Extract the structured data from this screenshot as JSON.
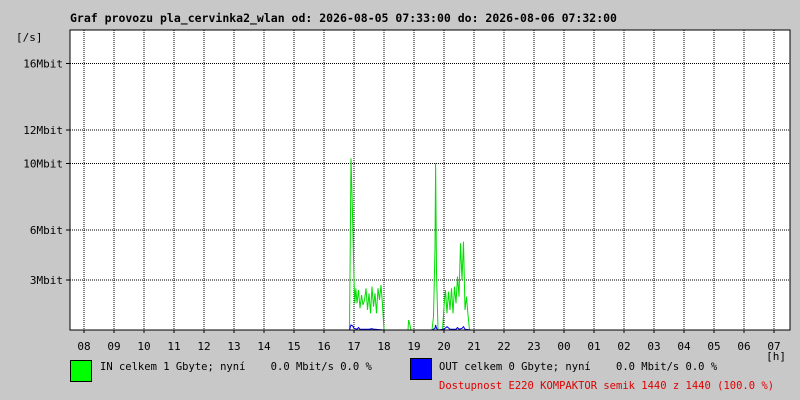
{
  "chart_data": {
    "type": "line",
    "title": "Graf provozu pla_cervinka2_wlan od: 2026-08-05 07:33:00 do: 2026-08-06 07:32:00",
    "ylabel": "[/s]",
    "xlabel": "[h]",
    "ylim": [
      0,
      18
    ],
    "x_ticks": [
      "08",
      "09",
      "10",
      "11",
      "12",
      "13",
      "14",
      "15",
      "16",
      "17",
      "18",
      "19",
      "20",
      "21",
      "22",
      "23",
      "00",
      "01",
      "02",
      "03",
      "04",
      "05",
      "06",
      "07"
    ],
    "y_ticks": [
      {
        "value": 3,
        "label": "3Mbit"
      },
      {
        "value": 6,
        "label": "6Mbit"
      },
      {
        "value": 10,
        "label": "10Mbit"
      },
      {
        "value": 12,
        "label": "12Mbit"
      },
      {
        "value": 16,
        "label": "16Mbit"
      }
    ],
    "grid": true,
    "series": [
      {
        "name": "IN",
        "color": "#00dd00",
        "x": [
          16.85,
          16.9,
          16.95,
          17.0,
          17.03,
          17.06,
          17.1,
          17.15,
          17.2,
          17.25,
          17.3,
          17.35,
          17.4,
          17.45,
          17.5,
          17.55,
          17.6,
          17.65,
          17.7,
          17.75,
          17.8,
          17.85,
          17.9,
          17.95,
          18.0,
          18.8,
          18.82,
          18.85,
          18.9,
          19.6,
          19.65,
          19.7,
          19.72,
          19.75,
          19.8,
          19.85,
          19.9,
          19.95,
          20.0,
          20.05,
          20.1,
          20.15,
          20.2,
          20.25,
          20.3,
          20.35,
          20.4,
          20.45,
          20.5,
          20.55,
          20.6,
          20.65,
          20.7,
          20.75,
          20.8,
          20.85,
          20.9
        ],
        "values": [
          0,
          10.3,
          7.0,
          3.0,
          1.6,
          2.5,
          1.6,
          2.4,
          1.3,
          2.1,
          1.5,
          1.8,
          2.5,
          1.2,
          2.2,
          1.0,
          2.6,
          1.4,
          2.2,
          1.0,
          2.5,
          1.8,
          2.7,
          1.5,
          0,
          0,
          0.6,
          0.4,
          0,
          0,
          0.8,
          4.9,
          10.0,
          3.5,
          0,
          0,
          0,
          0,
          1.4,
          2.4,
          1.0,
          2.3,
          1.2,
          2.5,
          1.0,
          2.6,
          1.6,
          3.2,
          2.0,
          5.2,
          3.0,
          5.3,
          1.2,
          2.0,
          0.9,
          0,
          0
        ]
      },
      {
        "name": "OUT",
        "color": "#0000ee",
        "x": [
          16.85,
          16.9,
          16.95,
          17.0,
          17.1,
          17.15,
          17.2,
          17.3,
          17.5,
          17.6,
          17.65,
          17.7,
          18.0,
          19.6,
          19.7,
          19.72,
          19.75,
          19.8,
          20.0,
          20.1,
          20.2,
          20.4,
          20.45,
          20.5,
          20.6,
          20.65,
          20.7,
          20.9
        ],
        "values": [
          0,
          0.3,
          0.25,
          0.1,
          0.05,
          0.15,
          0.05,
          0.05,
          0.05,
          0.08,
          0.05,
          0.05,
          0,
          0,
          0.1,
          0.3,
          0.1,
          0,
          0.05,
          0.2,
          0.05,
          0.05,
          0.15,
          0.05,
          0.1,
          0.2,
          0.05,
          0
        ]
      }
    ]
  },
  "legend": {
    "in_color": "#00ff00",
    "out_color": "#0000ff",
    "in_text": "IN celkem 1 Gbyte; nyní    0.0 Mbit/s 0.0 %",
    "out_text": "OUT celkem 0 Gbyte; nyní    0.0 Mbit/s 0.0 %",
    "availability": "Dostupnost E220 KOMPAKTOR semik 1440 z 1440 (100.0 %)"
  }
}
